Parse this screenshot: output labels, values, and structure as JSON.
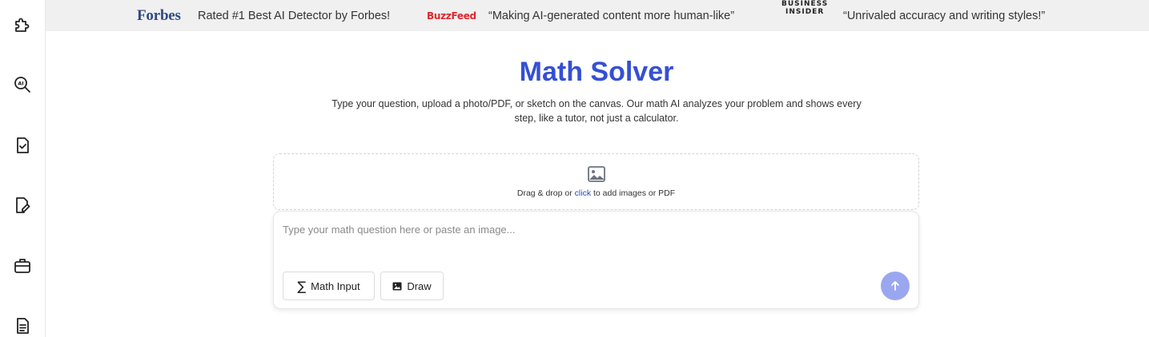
{
  "sidebar": {
    "items": [
      {
        "icon": "puzzle-icon"
      },
      {
        "icon": "ai-detector-search-icon"
      },
      {
        "icon": "checklist-document-icon"
      },
      {
        "icon": "document-edit-icon"
      },
      {
        "icon": "briefcase-icon"
      },
      {
        "icon": "text-document-icon"
      }
    ]
  },
  "banner": {
    "forbes_logo": "Forbes",
    "forbes_quote": "Rated #1 Best AI Detector by Forbes!",
    "buzzfeed_logo": "BuzzFeed",
    "buzzfeed_quote": "“Making AI-generated content more human-like”",
    "bi_logo_line1": "BUSINESS",
    "bi_logo_line2": "INSIDER",
    "bi_quote": "“Unrivaled accuracy and writing styles!”"
  },
  "main": {
    "title": "Math Solver",
    "subtitle": "Type your question, upload a photo/PDF, or sketch on the canvas. Our math AI analyzes your problem and shows every step, like a tutor, not just a calculator."
  },
  "dropzone": {
    "text_before": "Drag & drop or ",
    "link": "click",
    "text_after": " to add images or PDF"
  },
  "input": {
    "placeholder": "Type your math question here or paste an image...",
    "value": "",
    "math_input_label": "Math Input",
    "sigma_symbol": "∑",
    "draw_label": "Draw"
  },
  "colors": {
    "accent": "#3550d4",
    "send_button": "#9aa7f0",
    "banner_bg": "#f0f0f0",
    "forbes": "#2f4a84",
    "buzzfeed": "#e0262b"
  }
}
